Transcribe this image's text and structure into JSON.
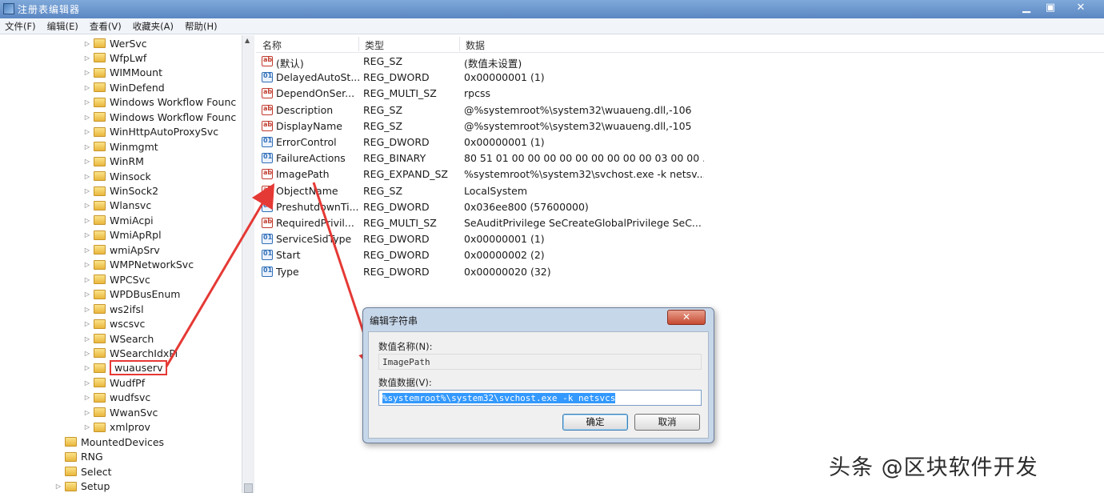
{
  "window": {
    "title": "注册表编辑器",
    "controls": {
      "minimize": "▁",
      "maximize": "▣",
      "close": "✕"
    }
  },
  "menu": [
    "文件(F)",
    "编辑(E)",
    "查看(V)",
    "收藏夹(A)",
    "帮助(H)"
  ],
  "tree": {
    "items": [
      {
        "label": "WerSvc",
        "depth": 1,
        "expandable": true
      },
      {
        "label": "WfpLwf",
        "depth": 1,
        "expandable": true
      },
      {
        "label": "WIMMount",
        "depth": 1,
        "expandable": true
      },
      {
        "label": "WinDefend",
        "depth": 1,
        "expandable": true
      },
      {
        "label": "Windows Workflow Founc",
        "depth": 1,
        "expandable": true
      },
      {
        "label": "Windows Workflow Founc",
        "depth": 1,
        "expandable": true
      },
      {
        "label": "WinHttpAutoProxySvc",
        "depth": 1,
        "expandable": true
      },
      {
        "label": "Winmgmt",
        "depth": 1,
        "expandable": true
      },
      {
        "label": "WinRM",
        "depth": 1,
        "expandable": true
      },
      {
        "label": "Winsock",
        "depth": 1,
        "expandable": true
      },
      {
        "label": "WinSock2",
        "depth": 1,
        "expandable": true
      },
      {
        "label": "Wlansvc",
        "depth": 1,
        "expandable": true
      },
      {
        "label": "WmiAcpi",
        "depth": 1,
        "expandable": true
      },
      {
        "label": "WmiApRpl",
        "depth": 1,
        "expandable": true
      },
      {
        "label": "wmiApSrv",
        "depth": 1,
        "expandable": true
      },
      {
        "label": "WMPNetworkSvc",
        "depth": 1,
        "expandable": true
      },
      {
        "label": "WPCSvc",
        "depth": 1,
        "expandable": true
      },
      {
        "label": "WPDBusEnum",
        "depth": 1,
        "expandable": true
      },
      {
        "label": "ws2ifsl",
        "depth": 1,
        "expandable": true
      },
      {
        "label": "wscsvc",
        "depth": 1,
        "expandable": true
      },
      {
        "label": "WSearch",
        "depth": 1,
        "expandable": true
      },
      {
        "label": "WSearchIdxPi",
        "depth": 1,
        "expandable": true
      },
      {
        "label": "wuauserv",
        "depth": 1,
        "expandable": true,
        "selected": true
      },
      {
        "label": "WudfPf",
        "depth": 1,
        "expandable": true
      },
      {
        "label": "wudfsvc",
        "depth": 1,
        "expandable": true
      },
      {
        "label": "WwanSvc",
        "depth": 1,
        "expandable": true
      },
      {
        "label": "xmlprov",
        "depth": 1,
        "expandable": true
      },
      {
        "label": "MountedDevices",
        "depth": 0,
        "expandable": false
      },
      {
        "label": "RNG",
        "depth": 0,
        "expandable": false
      },
      {
        "label": "Select",
        "depth": 0,
        "expandable": false
      },
      {
        "label": "Setup",
        "depth": 0,
        "expandable": true
      }
    ]
  },
  "list": {
    "columns": {
      "name": "名称",
      "type": "类型",
      "data": "数据"
    },
    "rows": [
      {
        "icon": "string-value-icon",
        "name": "(默认)",
        "type": "REG_SZ",
        "data": "(数值未设置)"
      },
      {
        "icon": "binary-value-icon",
        "name": "DelayedAutoSt...",
        "type": "REG_DWORD",
        "data": "0x00000001 (1)"
      },
      {
        "icon": "string-value-icon",
        "name": "DependOnSer...",
        "type": "REG_MULTI_SZ",
        "data": "rpcss"
      },
      {
        "icon": "string-value-icon",
        "name": "Description",
        "type": "REG_SZ",
        "data": "@%systemroot%\\system32\\wuaueng.dll,-106"
      },
      {
        "icon": "string-value-icon",
        "name": "DisplayName",
        "type": "REG_SZ",
        "data": "@%systemroot%\\system32\\wuaueng.dll,-105"
      },
      {
        "icon": "binary-value-icon",
        "name": "ErrorControl",
        "type": "REG_DWORD",
        "data": "0x00000001 (1)"
      },
      {
        "icon": "binary-value-icon",
        "name": "FailureActions",
        "type": "REG_BINARY",
        "data": "80 51 01 00 00 00 00 00 00 00 00 00 03 00 00 ..."
      },
      {
        "icon": "string-value-icon",
        "name": "ImagePath",
        "type": "REG_EXPAND_SZ",
        "data": "%systemroot%\\system32\\svchost.exe -k netsv..."
      },
      {
        "icon": "string-value-icon",
        "name": "ObjectName",
        "type": "REG_SZ",
        "data": "LocalSystem"
      },
      {
        "icon": "binary-value-icon",
        "name": "PreshutdownTi...",
        "type": "REG_DWORD",
        "data": "0x036ee800 (57600000)"
      },
      {
        "icon": "string-value-icon",
        "name": "RequiredPrivil...",
        "type": "REG_MULTI_SZ",
        "data": "SeAuditPrivilege SeCreateGlobalPrivilege SeC..."
      },
      {
        "icon": "binary-value-icon",
        "name": "ServiceSidType",
        "type": "REG_DWORD",
        "data": "0x00000001 (1)"
      },
      {
        "icon": "binary-value-icon",
        "name": "Start",
        "type": "REG_DWORD",
        "data": "0x00000002 (2)"
      },
      {
        "icon": "binary-value-icon",
        "name": "Type",
        "type": "REG_DWORD",
        "data": "0x00000020 (32)"
      }
    ]
  },
  "dialog": {
    "title": "编辑字符串",
    "close": "✕",
    "name_label": "数值名称(N):",
    "name_value": "ImagePath",
    "data_label": "数值数据(V):",
    "data_value": "%systemroot%\\system32\\svchost.exe -k netsvcs",
    "ok": "确定",
    "cancel": "取消"
  },
  "watermark": "头条 @区块软件开发",
  "colors": {
    "annotation": "#e53935",
    "selection": "#3399ff"
  }
}
